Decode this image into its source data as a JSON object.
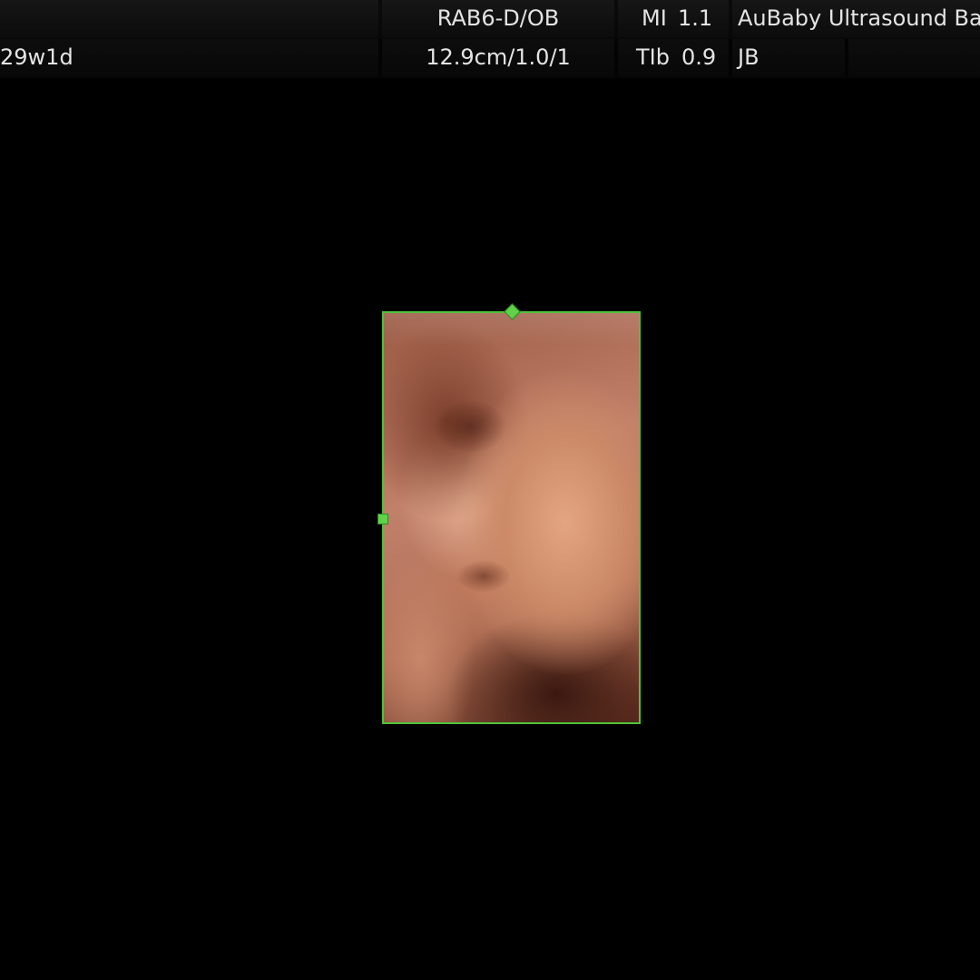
{
  "header": {
    "row1": {
      "probe_preset": "RAB6-D/OB",
      "mi_label": "MI",
      "mi_value": "1.1",
      "facility": "AuBaby Ultrasound Ba"
    },
    "row2": {
      "gestational_age": "29w1d",
      "depth_freq": "12.9cm/1.0/1",
      "tib_label": "TIb",
      "tib_value": "0.9",
      "operator": "JB"
    }
  },
  "viewport": {
    "render_mode": "3D surface render",
    "roi_color": "#4fc23c",
    "background_color": "#000000"
  },
  "icons": {
    "roi_top_handle": "diamond-handle-icon",
    "roi_left_handle": "square-handle-icon"
  }
}
